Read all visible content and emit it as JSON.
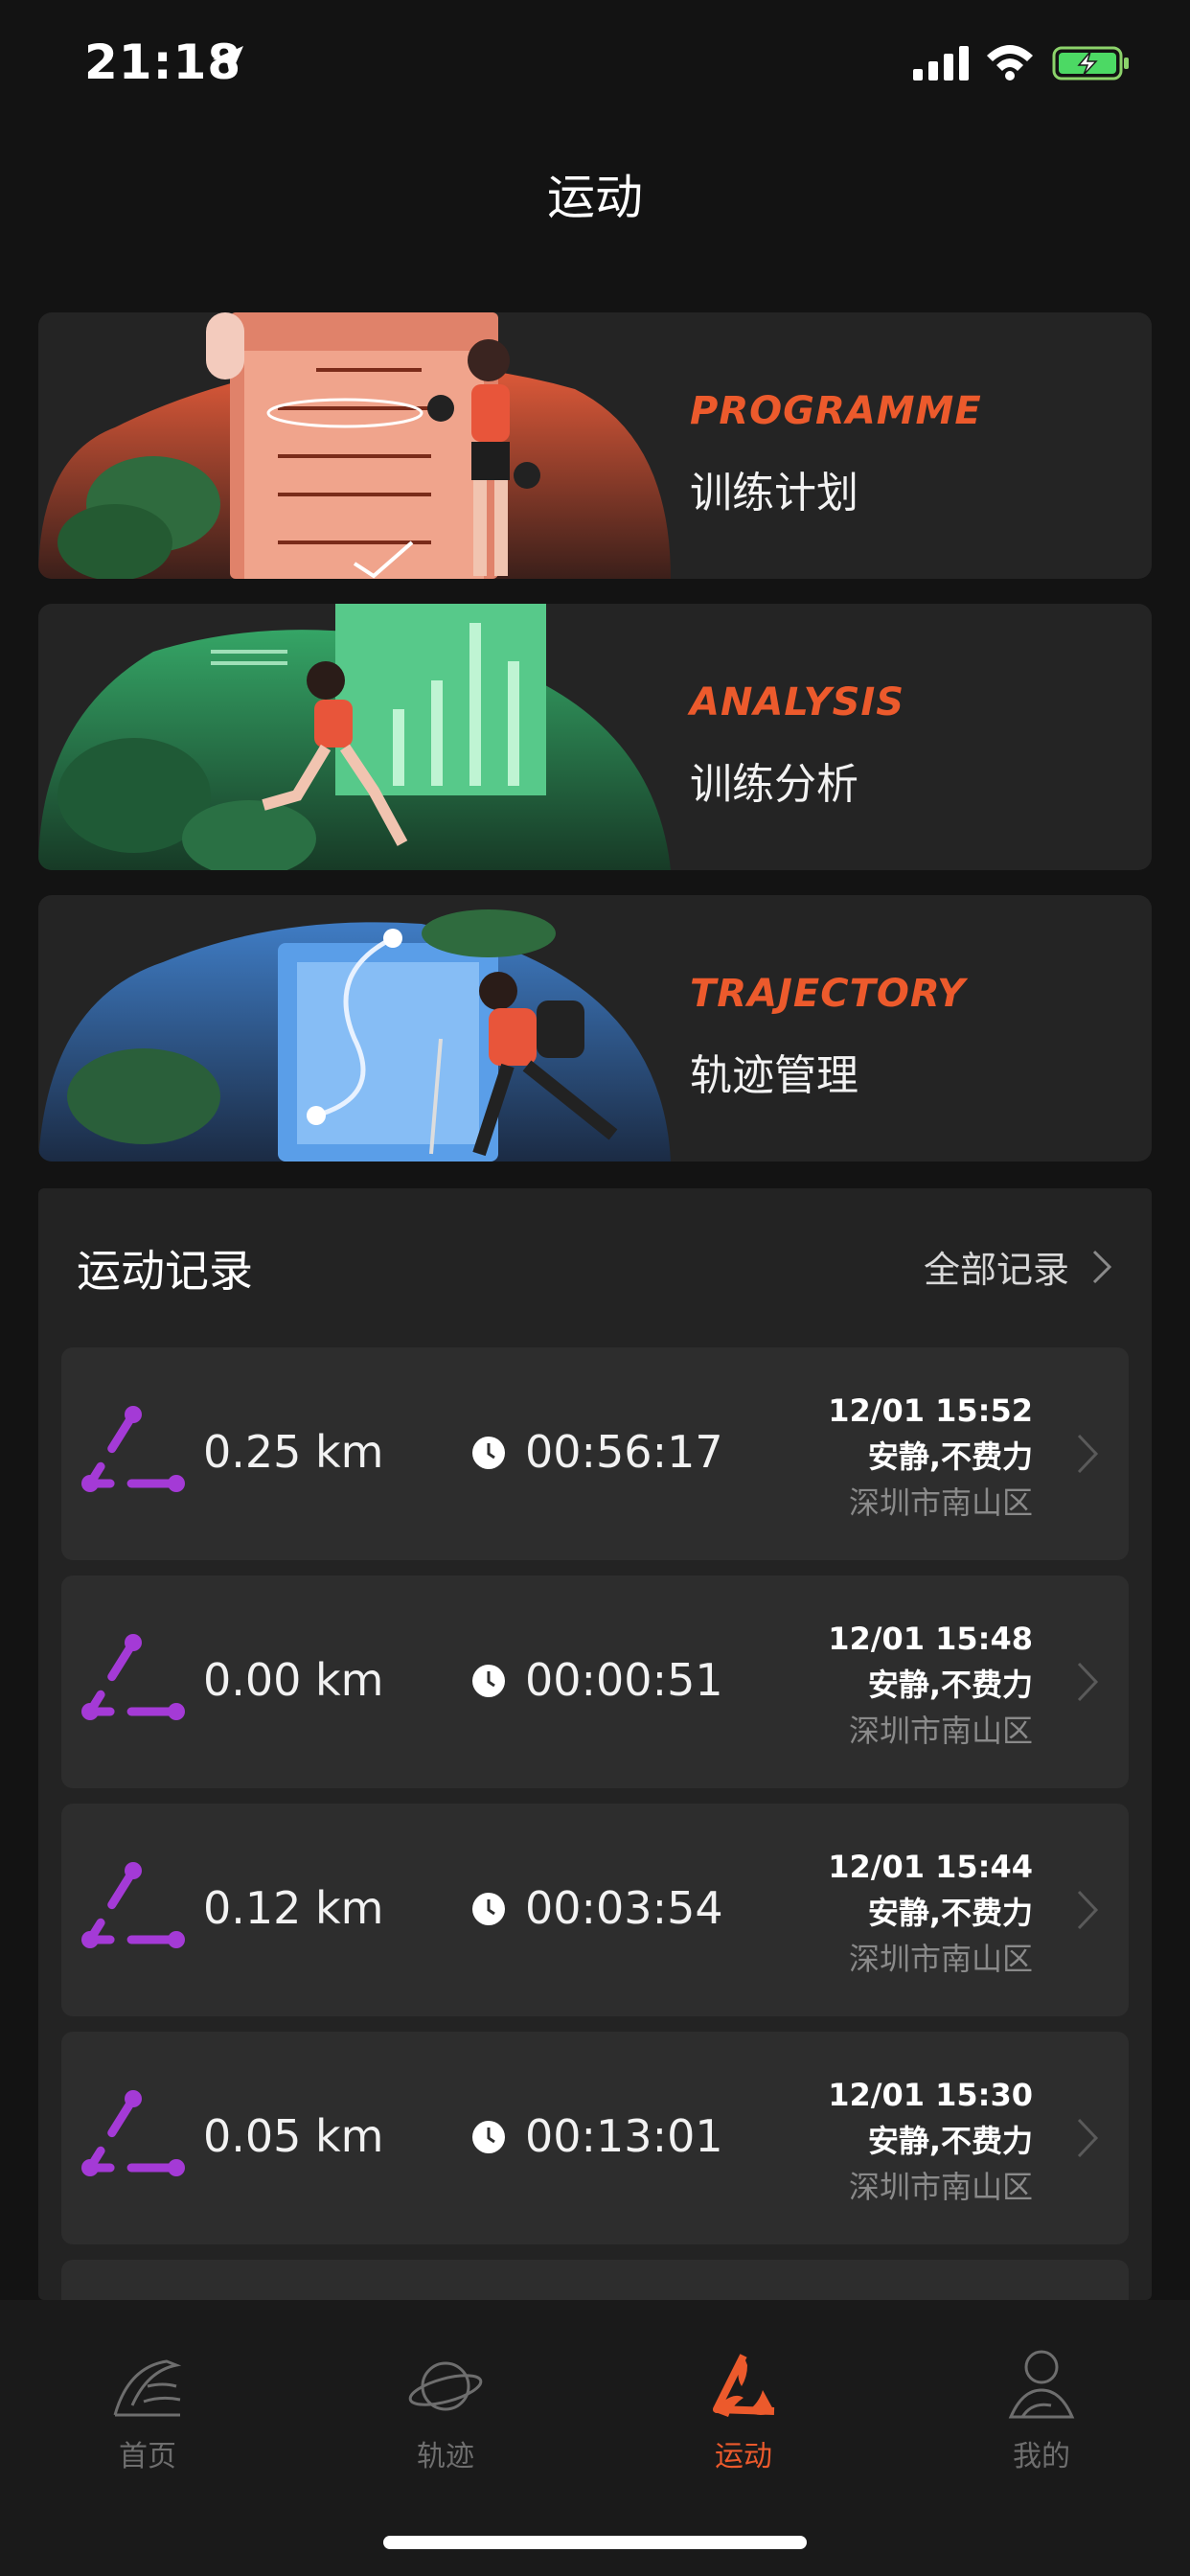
{
  "status_bar": {
    "time": "21:18"
  },
  "header": {
    "title": "运动"
  },
  "features": [
    {
      "en": "PROGRAMME",
      "cn": "训练计划"
    },
    {
      "en": "ANALYSIS",
      "cn": "训练分析"
    },
    {
      "en": "TRAJECTORY",
      "cn": "轨迹管理"
    }
  ],
  "records": {
    "title": "运动记录",
    "all_label": "全部记录",
    "items": [
      {
        "distance": "0.25 km",
        "duration": "00:56:17",
        "date": "12/01 15:52",
        "feel": "安静,不费力",
        "place": "深圳市南山区"
      },
      {
        "distance": "0.00 km",
        "duration": "00:00:51",
        "date": "12/01 15:48",
        "feel": "安静,不费力",
        "place": "深圳市南山区"
      },
      {
        "distance": "0.12 km",
        "duration": "00:03:54",
        "date": "12/01 15:44",
        "feel": "安静,不费力",
        "place": "深圳市南山区"
      },
      {
        "distance": "0.05 km",
        "duration": "00:13:01",
        "date": "12/01 15:30",
        "feel": "安静,不费力",
        "place": "深圳市南山区"
      }
    ]
  },
  "tabs": [
    {
      "label": "首页",
      "icon": "home-icon"
    },
    {
      "label": "轨迹",
      "icon": "planet-icon"
    },
    {
      "label": "运动",
      "icon": "sport-icon",
      "active": true
    },
    {
      "label": "我的",
      "icon": "profile-icon"
    }
  ],
  "colors": {
    "accent": "#ec5a2c",
    "purple": "#a43ad6",
    "background": "#131313",
    "card": "#242424"
  }
}
